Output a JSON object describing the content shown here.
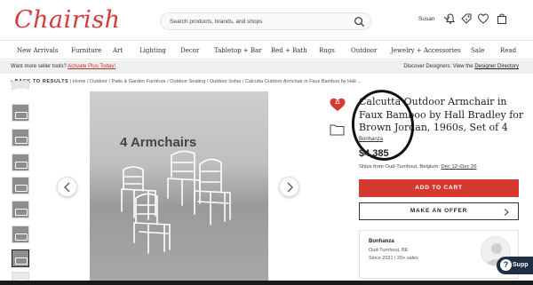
{
  "header": {
    "logo": "Chairish",
    "search_placeholder": "Search products, brands, and shops",
    "user_name": "Susan",
    "icons": [
      "search-icon",
      "bell-icon",
      "tag-icon",
      "heart-icon",
      "bag-icon"
    ]
  },
  "nav": {
    "items": [
      "New Arrivals",
      "Furniture",
      "Art",
      "Lighting",
      "Decor",
      "Tabletop + Bar",
      "Bed + Bath",
      "Rugs",
      "Outdoor",
      "Jewelry + Accessories",
      "Sale",
      "Read"
    ]
  },
  "promo": {
    "left_text": "Want more seller tools? ",
    "left_link": "Activate Plus Today!",
    "right_text": "Discover Designers: View the ",
    "right_link": "Designer Directory"
  },
  "breadcrumb": {
    "back": "‹ BACK TO RESULTS",
    "path": "| Home / Outdoor / Patio & Garden Furniture / Outdoor Seating / Outdoor Sofas / Calcutta Outdoor Armchair in Faux Bamboo by Hall ..."
  },
  "gallery": {
    "image_text": "4 Armchairs",
    "thumbnail_count": 8,
    "active_thumbnail": 7
  },
  "product": {
    "favorite_count": "21",
    "title": "Calcutta Outdoor Armchair in Faux Bamboo by Hall Bradley for Brown Jordan, 1960s, Set of 4",
    "seller_link": "Bonhanza",
    "price": "$4,385",
    "ships_prefix": "Ships from Oud-Turnhout, Belgium: ",
    "ships_dates": "Dec 12–Dec 26",
    "add_to_cart": "ADD TO CART",
    "make_offer": "MAKE AN OFFER"
  },
  "seller_card": {
    "name": "Bonhanza",
    "location": "Oud-Turnhout, BE",
    "since": "Since 2021  |  20+ sales"
  },
  "support": {
    "label": "Supp"
  },
  "colors": {
    "brand": "#d43a3a",
    "cta": "#d43a2f",
    "support_bg": "#1e2e44"
  }
}
